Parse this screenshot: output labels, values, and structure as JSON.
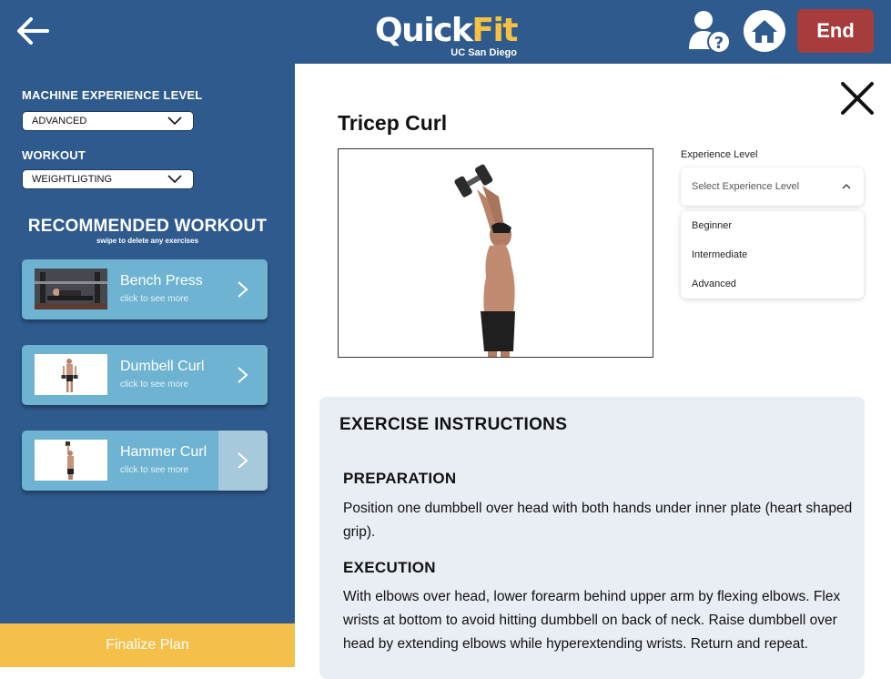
{
  "header": {
    "logo_quick": "Quick",
    "logo_fit": "Fit",
    "logo_sub": "UC San Diego",
    "end_label": "End",
    "colors": {
      "bar": "#2f5a8d",
      "end": "#a63c3c",
      "logo_accent": "#f5c043"
    },
    "icons": {
      "back": "arrow-left-icon",
      "help": "user-help-icon",
      "home": "home-icon"
    }
  },
  "sidebar": {
    "experience_label": "MACHINE EXPERIENCE LEVEL",
    "experience_value": "ADVANCED",
    "workout_label": "WORKOUT",
    "workout_value": "WEIGHTLIGTING",
    "recommended_title": "RECOMMENDED WORKOUT",
    "recommended_sub": "swipe to delete any exercises",
    "cards": [
      {
        "name": "Bench Press",
        "sub": "click to see more"
      },
      {
        "name": "Dumbell Curl",
        "sub": "click to see more"
      },
      {
        "name": "Hammer Curl",
        "sub": "click to see more"
      }
    ],
    "finalize_label": "Finalize Plan"
  },
  "main": {
    "title": "Tricep Curl",
    "experience": {
      "label": "Experience Level",
      "placeholder": "Select Experience Level",
      "options": [
        "Beginner",
        "Intermediate",
        "Advanced"
      ]
    },
    "instructions": {
      "title": "EXERCISE INSTRUCTIONS",
      "prep_heading": "PREPARATION",
      "prep_text": "Position one dumbbell over head with both hands under inner plate (heart shaped grip).",
      "exec_heading": "EXECUTION",
      "exec_text": "With elbows over head, lower forearm behind upper arm by flexing elbows. Flex wrists at bottom to avoid hitting dumbbell on back of neck. Raise dumbbell over head by extending elbows while hyperextending wrists. Return and repeat."
    }
  }
}
